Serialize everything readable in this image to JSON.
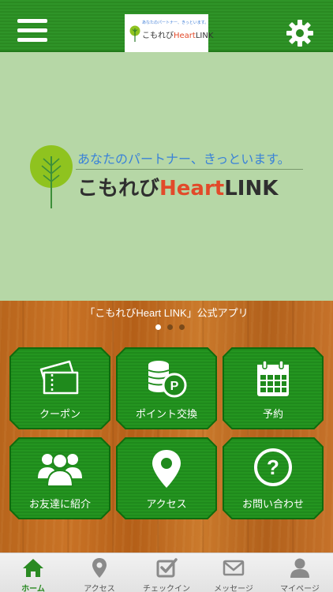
{
  "header": {
    "menu_icon": "hamburger-menu-icon",
    "settings_icon": "gear-icon",
    "logo": {
      "tagline": "あなたのパートナー、きっといます。",
      "name_main": "こもれび",
      "name_heart": "Heart",
      "name_link": "LINK"
    }
  },
  "hero": {
    "tagline": "あなたのパートナー、きっといます。",
    "name_main": "こもれび",
    "name_heart": "Heart",
    "name_link": "LINK",
    "caption": "「こもれびHeart LINK」公式アプリ",
    "slides_total": 3,
    "slide_active": 1
  },
  "tiles": [
    {
      "label": "クーポン",
      "icon": "ticket-icon"
    },
    {
      "label": "ポイント交換",
      "icon": "coins-icon"
    },
    {
      "label": "予約",
      "icon": "calendar-icon"
    },
    {
      "label": "お友達に紹介",
      "icon": "users-icon"
    },
    {
      "label": "アクセス",
      "icon": "map-pin-icon"
    },
    {
      "label": "お問い合わせ",
      "icon": "question-icon"
    }
  ],
  "bottom_nav": [
    {
      "label": "ホーム",
      "icon": "home-icon",
      "active": true
    },
    {
      "label": "アクセス",
      "icon": "map-pin-icon",
      "active": false
    },
    {
      "label": "チェックイン",
      "icon": "checkin-icon",
      "active": false
    },
    {
      "label": "メッセージ",
      "icon": "envelope-icon",
      "active": false
    },
    {
      "label": "マイページ",
      "icon": "person-icon",
      "active": false
    }
  ],
  "colors": {
    "header_green": "#2a8a22",
    "tile_green": "#1f8a1c",
    "hero_bg": "#b6d7a6",
    "wood": "#c06a22",
    "active_nav": "#2a8a22",
    "brand_red": "#e24a2a",
    "brand_blue": "#3a82d8"
  }
}
